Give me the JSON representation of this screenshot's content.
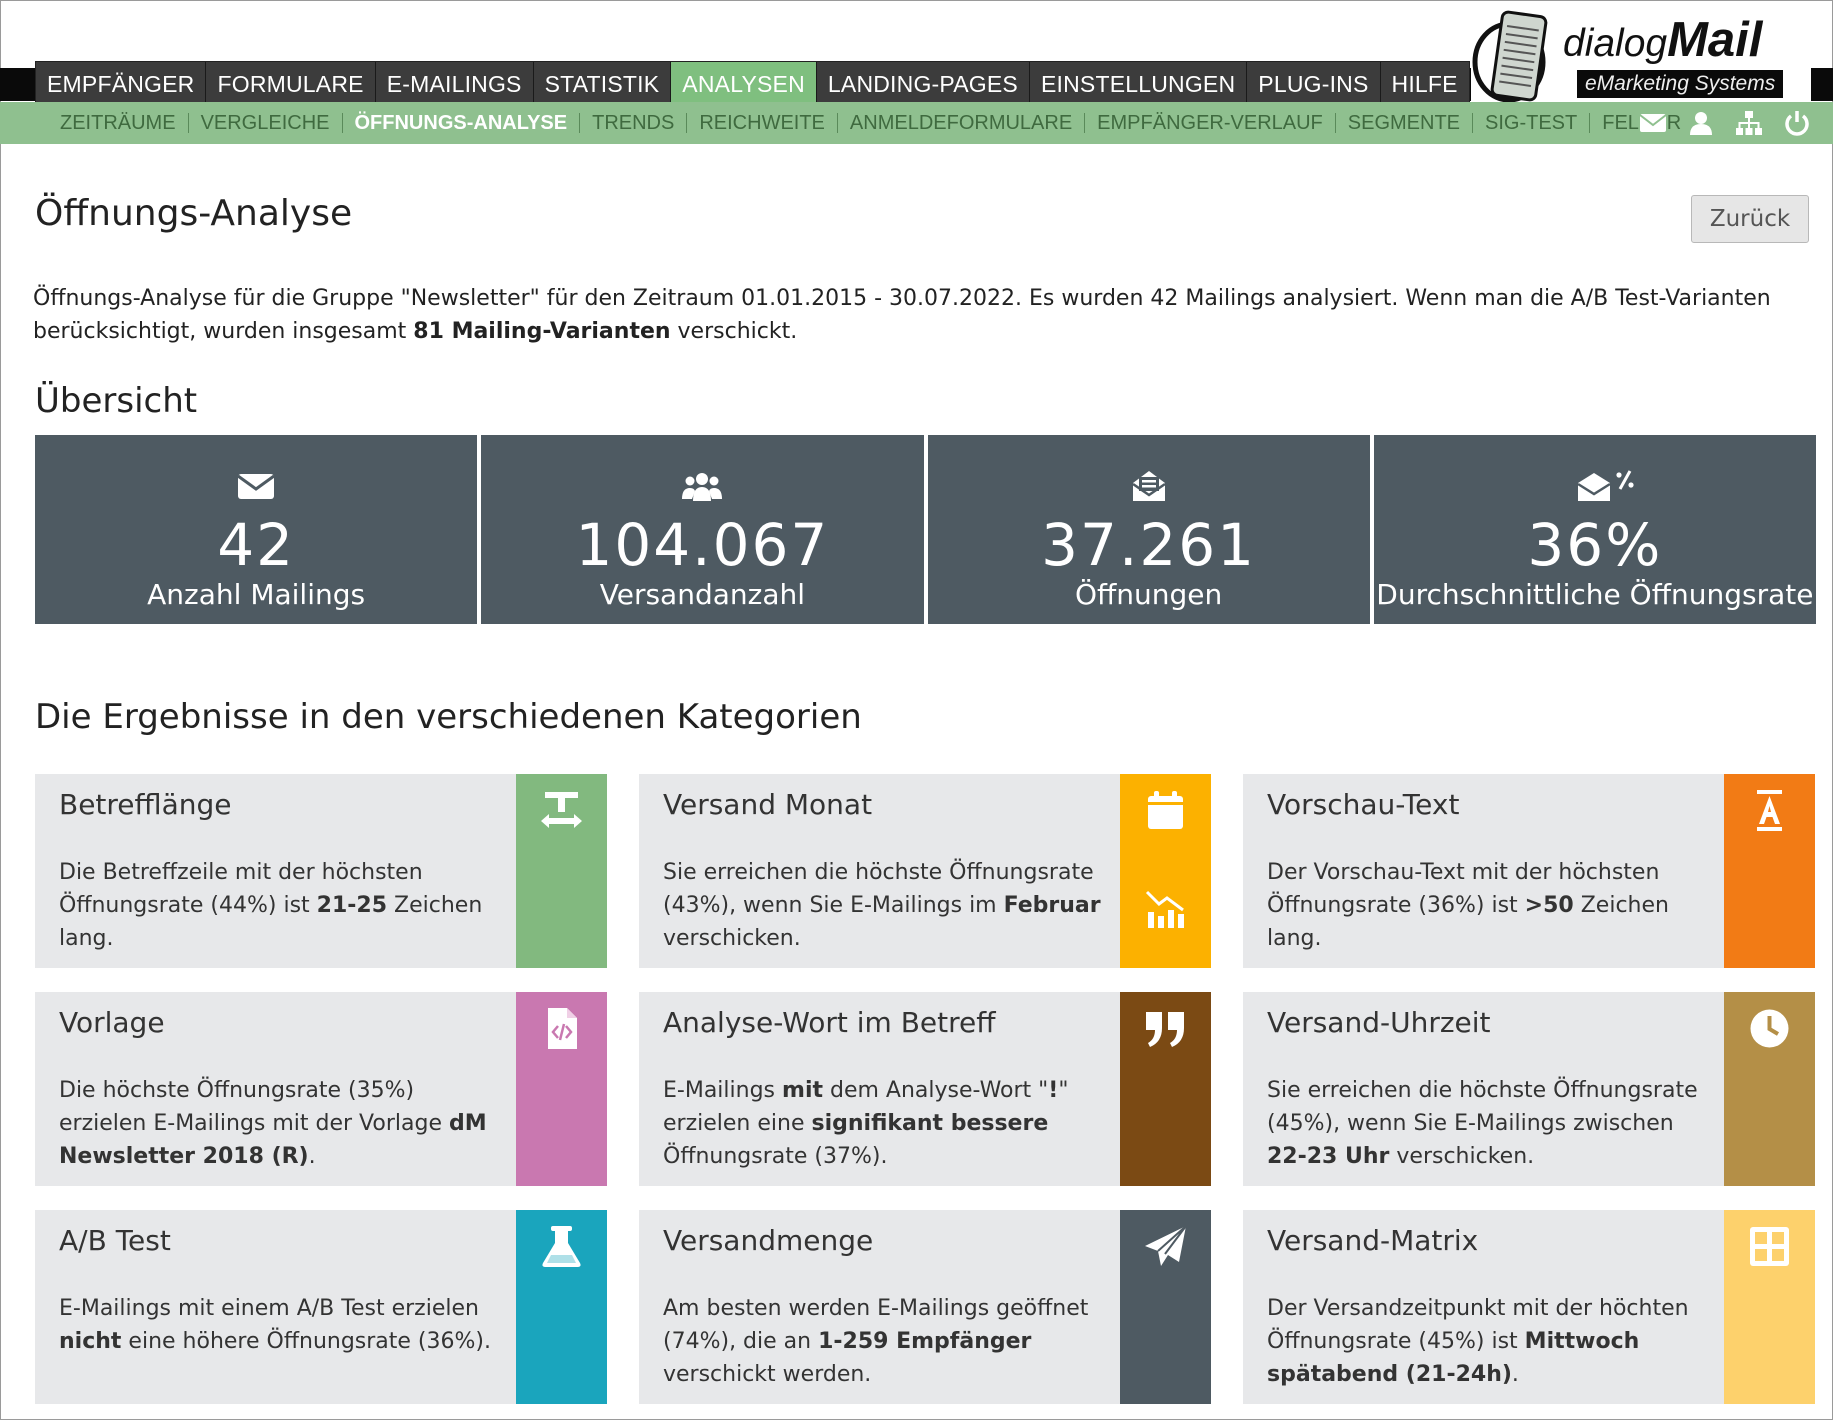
{
  "brand": {
    "logo_word1": "dialog",
    "logo_word2": "Mail",
    "tagline": "eMarketing Systems"
  },
  "main_nav": [
    {
      "label": "EMPFÄNGER",
      "active": false
    },
    {
      "label": "FORMULARE",
      "active": false
    },
    {
      "label": "E-MAILINGS",
      "active": false
    },
    {
      "label": "STATISTIK",
      "active": false
    },
    {
      "label": "ANALYSEN",
      "active": true
    },
    {
      "label": "LANDING-PAGES",
      "active": false
    },
    {
      "label": "EINSTELLUNGEN",
      "active": false
    },
    {
      "label": "PLUG-INS",
      "active": false
    },
    {
      "label": "HILFE",
      "active": false
    }
  ],
  "sub_nav": [
    {
      "label": "ZEITRÄUME",
      "active": false
    },
    {
      "label": "VERGLEICHE",
      "active": false
    },
    {
      "label": "ÖFFNUNGS-ANALYSE",
      "active": true
    },
    {
      "label": "TRENDS",
      "active": false
    },
    {
      "label": "REICHWEITE",
      "active": false
    },
    {
      "label": "ANMELDEFORMULARE",
      "active": false
    },
    {
      "label": "EMPFÄNGER-VERLAUF",
      "active": false
    },
    {
      "label": "SEGMENTE",
      "active": false
    },
    {
      "label": "SIG-TEST",
      "active": false
    },
    {
      "label": "FELDER",
      "active": false
    }
  ],
  "sub_nav_icons": [
    "envelope-icon",
    "user-icon",
    "sitemap-icon",
    "power-icon"
  ],
  "colors": {
    "nav_active": "#7fbf7f",
    "subnav_bg": "#8fc08f",
    "stat_bg": "#4e5a62",
    "card_bg": "#e7e8ea"
  },
  "page": {
    "title": "Öffnungs-Analyse",
    "back_button": "Zurück",
    "intro_part1": "Öffnungs-Analyse für die Gruppe \"Newsletter\" für den Zeitraum 01.01.2015 - 30.07.2022. Es wurden 42 Mailings analysiert. Wenn man die A/B Test-Varianten berücksichtigt, wurden insgesamt ",
    "intro_bold": "81 Mailing-Varianten",
    "intro_part2": " verschickt.",
    "overview_heading": "Übersicht",
    "results_heading": "Die Ergebnisse in den verschiedenen Kategorien"
  },
  "stats": [
    {
      "icon": "envelope-icon",
      "value": "42",
      "label": "Anzahl Mailings"
    },
    {
      "icon": "users-icon",
      "value": "104.067",
      "label": "Versandanzahl"
    },
    {
      "icon": "open-envelope-icon",
      "value": "37.261",
      "label": "Öffnungen"
    },
    {
      "icon": "envelope-percent-icon",
      "value": "36%",
      "label": "Durchschnittliche Öffnungsrate"
    }
  ],
  "cards": [
    {
      "title": "Betrefflänge",
      "icon": "text-width-icon",
      "color": "#82b97f",
      "text": [
        [
          "Die Betreffzeile mit der höchsten Öffnungsrate (44%) ist ",
          false
        ],
        [
          "21-25",
          true
        ],
        [
          " Zeichen lang.",
          false
        ]
      ]
    },
    {
      "title": "Versand Monat",
      "icon": "calendar-icon",
      "icon2": "chart-icon",
      "color": "#fcb100",
      "text": [
        [
          "Sie erreichen die höchste Öffnungsrate (43%), wenn Sie E-Mailings im ",
          false
        ],
        [
          "Februar",
          true
        ],
        [
          " verschicken.",
          false
        ]
      ]
    },
    {
      "title": "Vorschau-Text",
      "icon": "text-height-icon",
      "color": "#f27b15",
      "text": [
        [
          "Der Vorschau-Text mit der höchsten Öffnungsrate (36%) ist ",
          false
        ],
        [
          ">50",
          true
        ],
        [
          " Zeichen lang.",
          false
        ]
      ]
    },
    {
      "title": "Vorlage",
      "icon": "file-code-icon",
      "color": "#c978b0",
      "text": [
        [
          "Die höchste Öffnungsrate (35%) erzielen E-Mailings mit der Vorlage ",
          false
        ],
        [
          "dM Newsletter 2018 (R)",
          true
        ],
        [
          ".",
          false
        ]
      ]
    },
    {
      "title": "Analyse-Wort im Betreff",
      "icon": "quote-icon",
      "color": "#7b4a14",
      "text": [
        [
          "E-Mailings ",
          false
        ],
        [
          "mit",
          true
        ],
        [
          " dem Analyse-Wort \"",
          false
        ],
        [
          "!",
          true
        ],
        [
          "\" erzielen eine ",
          false
        ],
        [
          "signifikant bessere",
          true
        ],
        [
          " Öffnungsrate (37%).",
          false
        ]
      ]
    },
    {
      "title": "Versand-Uhrzeit",
      "icon": "clock-icon",
      "color": "#b48f47",
      "text": [
        [
          "Sie erreichen die höchste Öffnungsrate (45%), wenn Sie E-Mailings zwischen ",
          false
        ],
        [
          "22-23 Uhr",
          true
        ],
        [
          " verschicken.",
          false
        ]
      ]
    },
    {
      "title": "A/B Test",
      "icon": "flask-icon",
      "color": "#1aa5bd",
      "text": [
        [
          "E-Mailings mit einem A/B Test erzielen ",
          false
        ],
        [
          "nicht",
          true
        ],
        [
          " eine höhere Öffnungsrate (36%).",
          false
        ]
      ]
    },
    {
      "title": "Versandmenge",
      "icon": "paper-plane-icon",
      "color": "#4e5a62",
      "text": [
        [
          "Am besten werden E-Mailings geöffnet (74%), die an ",
          false
        ],
        [
          "1-259 Empfänger",
          true
        ],
        [
          " verschickt werden.",
          false
        ]
      ]
    },
    {
      "title": "Versand-Matrix",
      "icon": "grid-icon",
      "color": "#fdd16c",
      "text": [
        [
          "Der Versandzeitpunkt mit der höchten Öffnungsrate (45%) ist ",
          false
        ],
        [
          "Mittwoch spätabend (21-24h)",
          true
        ],
        [
          ".",
          false
        ]
      ]
    }
  ]
}
